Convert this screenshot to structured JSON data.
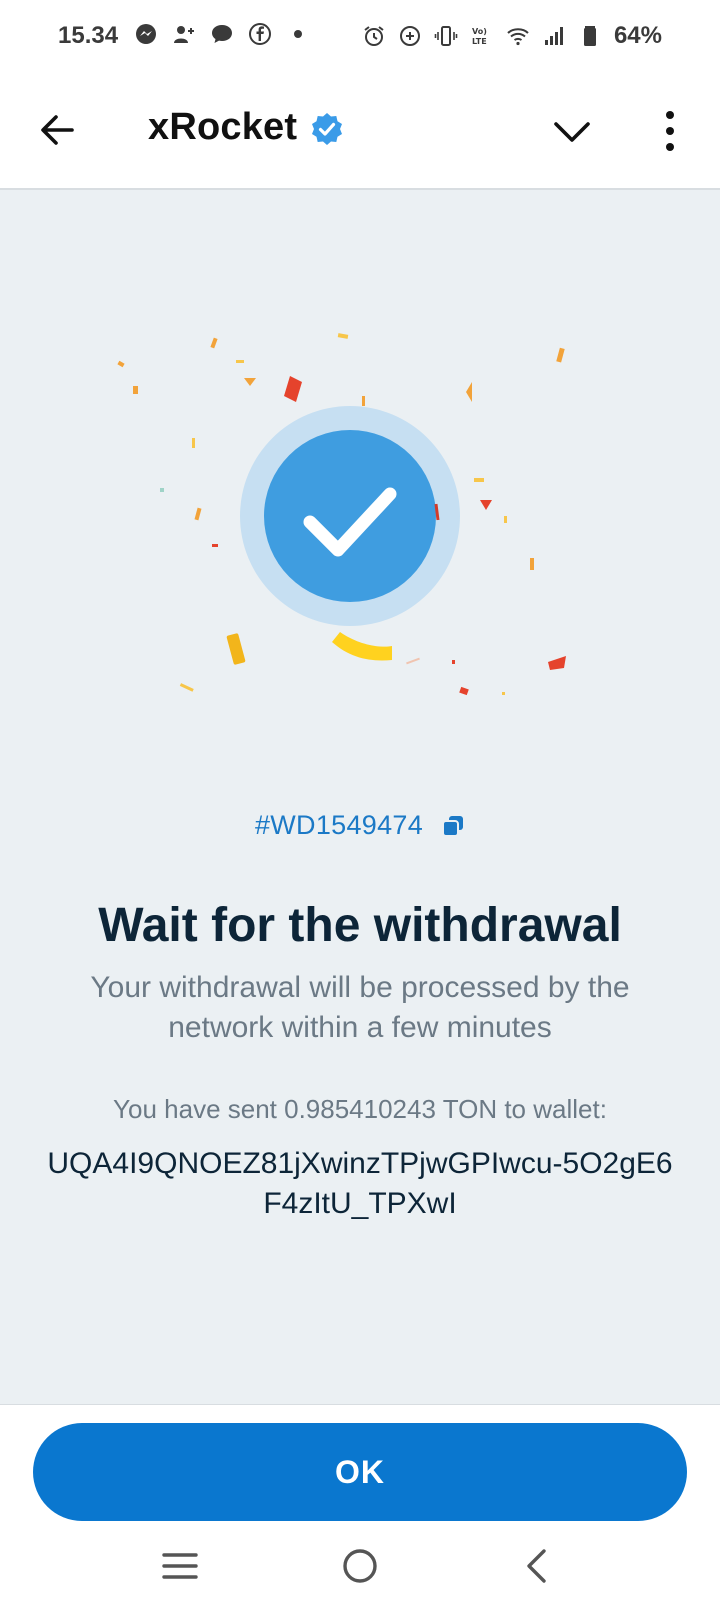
{
  "status_bar": {
    "time": "15.34",
    "left_icons": [
      "messenger-icon",
      "add-contact-icon",
      "chat-bubble-icon",
      "facebook-icon",
      "dot-icon"
    ],
    "right_icons": [
      "alarm-icon",
      "data-saver-icon",
      "vibrate-icon",
      "volte-icon",
      "wifi-icon",
      "signal-icon",
      "battery-icon"
    ],
    "battery": "64%"
  },
  "header": {
    "title": "xRocket",
    "verified": true,
    "icons": [
      "back-arrow-icon",
      "verified-badge-icon",
      "chevron-down-icon",
      "more-vertical-icon"
    ]
  },
  "main": {
    "transaction_id": "#WD1549474",
    "title": "Wait for the withdrawal",
    "subtitle": "Your withdrawal will be processed by the network within a few minutes",
    "sent_text": "You have sent 0.985410243 TON to wallet:",
    "wallet_address": "UQA4I9QNOEZ81jXwinzTPjwGPIwcu-5O2gE6F4zItU_TPXwI"
  },
  "footer": {
    "ok_label": "OK"
  },
  "nav": {
    "icons": [
      "recent-apps-icon",
      "home-icon",
      "back-icon"
    ]
  },
  "colors": {
    "accent": "#0a77cf",
    "check_circle": "#3f9de0",
    "check_halo": "#c6dff2",
    "background": "#ebf0f3",
    "muted_text": "#6b7985",
    "title_text": "#0d2538"
  }
}
